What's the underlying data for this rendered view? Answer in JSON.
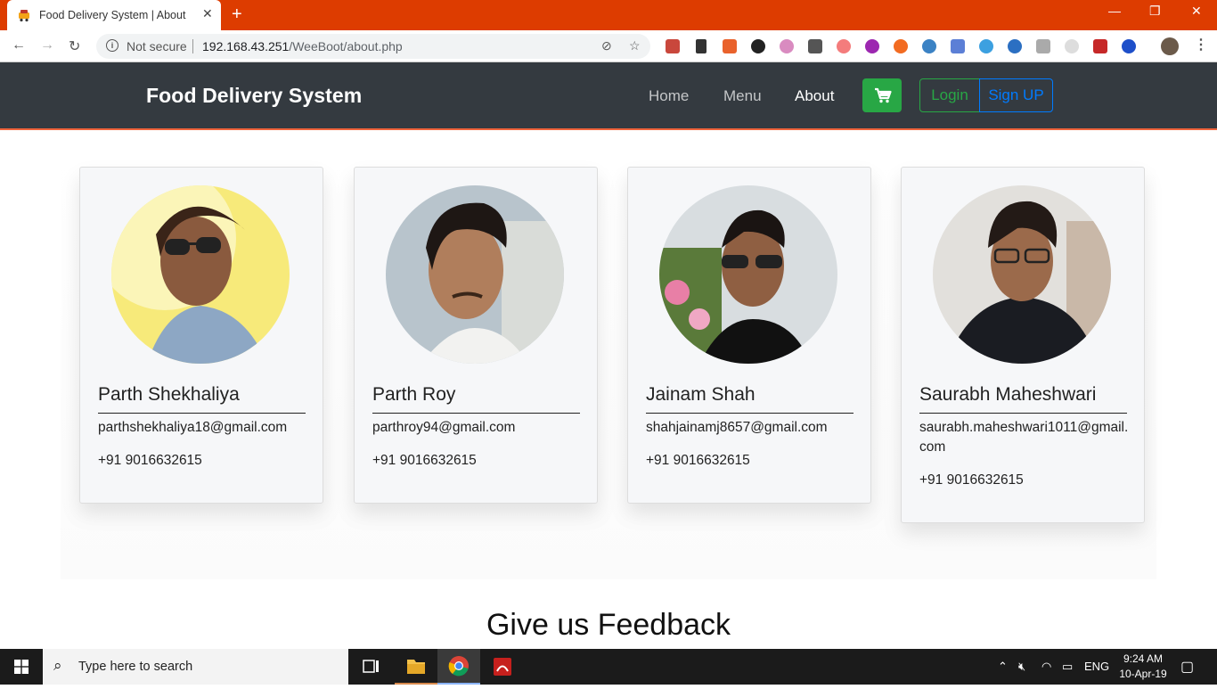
{
  "browser": {
    "tab_title": "Food Delivery System | About",
    "tab_close": "✕",
    "new_tab": "+",
    "security_label": "Not secure",
    "url_host": "192.168.43.251",
    "url_path": "/WeeBoot/about.php",
    "window_controls": [
      "—",
      "❐",
      "✕"
    ]
  },
  "site": {
    "brand": "Food Delivery System",
    "nav": [
      {
        "label": "Home",
        "active": false
      },
      {
        "label": "Menu",
        "active": false
      },
      {
        "label": "About",
        "active": true
      }
    ],
    "login": "Login",
    "signup": "Sign UP",
    "accent_color": "#f0643c",
    "green": "#28a745",
    "blue": "#007bff"
  },
  "team": [
    {
      "name": "Parth Shekhaliya",
      "email": "parthshekhaliya18@gmail.com",
      "phone": "+91 9016632615"
    },
    {
      "name": "Parth Roy",
      "email": "parthroy94@gmail.com",
      "phone": "+91 9016632615"
    },
    {
      "name": "Jainam Shah",
      "email": "shahjainamj8657@gmail.com",
      "phone": "+91 9016632615"
    },
    {
      "name": "Saurabh Maheshwari",
      "email": "saurabh.maheshwari1011@gmail.com",
      "phone": "+91 9016632615"
    }
  ],
  "feedback_heading": "Give us Feedback",
  "taskbar": {
    "search_placeholder": "Type here to search",
    "language": "ENG",
    "time": "9:24 AM",
    "date": "10-Apr-19"
  }
}
